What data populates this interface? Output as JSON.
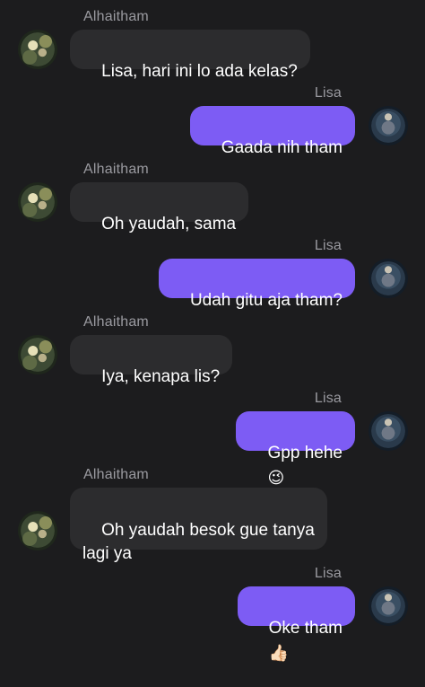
{
  "messages": [
    {
      "sender": "Alhaitham",
      "text": "Lisa, hari ini lo ada kelas?"
    },
    {
      "sender": "Lisa",
      "text": "Gaada nih tham"
    },
    {
      "sender": "Alhaitham",
      "text": "Oh yaudah, sama"
    },
    {
      "sender": "Lisa",
      "text": "Udah gitu aja tham?"
    },
    {
      "sender": "Alhaitham",
      "text": "Iya, kenapa lis?"
    },
    {
      "sender": "Lisa",
      "text": "Gpp hehe",
      "emoji": "😉"
    },
    {
      "sender": "Alhaitham",
      "text": "Oh yaudah besok gue tanya\nlagi ya"
    },
    {
      "sender": "Lisa",
      "text": "Oke tham",
      "emoji": "👍🏻"
    }
  ],
  "colors": {
    "background": "#1c1c1e",
    "incoming_bubble": "#2c2c2e",
    "outgoing_bubble": "#7d5cf4",
    "sender_name": "#9a9aa0"
  },
  "icons": {
    "alhaitham_avatar": "alhaitham-avatar",
    "lisa_avatar": "lisa-avatar"
  }
}
